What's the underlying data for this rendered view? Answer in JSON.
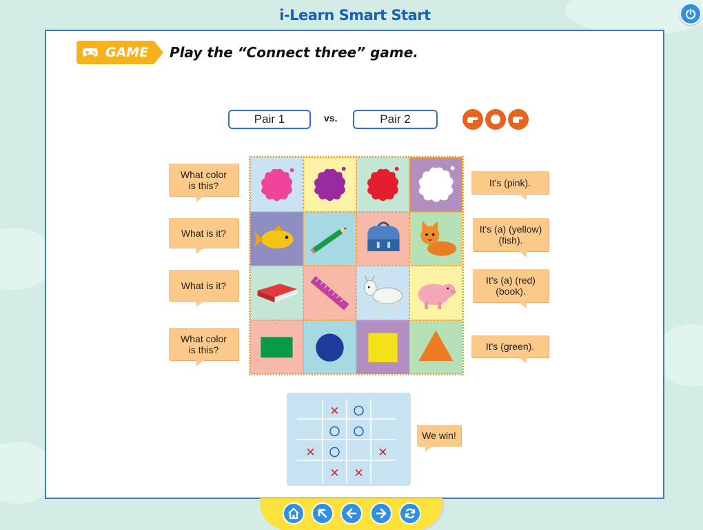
{
  "app": {
    "title": "i-Learn Smart Start"
  },
  "activity": {
    "badge": "GAME",
    "instruction": "Play the “Connect three” game."
  },
  "pairs": {
    "pair1": "Pair 1",
    "vs": "vs.",
    "pair2": "Pair 2"
  },
  "hands": [
    "hand-point-icon",
    "hand-fist-icon",
    "hand-point-icon"
  ],
  "questions": [
    "What color is this?",
    "What is it?",
    "What is it?",
    "What color is this?"
  ],
  "answers": [
    "It's (pink).",
    "It's (a) (yellow) (fish).",
    "It's (a) (red) (book).",
    "It's (green)."
  ],
  "board": {
    "rows": [
      [
        "pink-paint-splat",
        "purple-paint-splat",
        "red-paint-splat",
        "white-paint-splat"
      ],
      [
        "yellow-fish",
        "green-pencil",
        "blue-schoolbag",
        "orange-cat"
      ],
      [
        "red-book",
        "pink-ruler",
        "white-goat",
        "pink-pig"
      ],
      [
        "green-rectangle",
        "blue-circle",
        "yellow-square",
        "orange-triangle"
      ]
    ],
    "colors": {
      "pink": "#f0449a",
      "purple": "#9a2a9f",
      "red": "#e41e2e",
      "green": "#0a9a46",
      "blue": "#1e3a9b",
      "yellow": "#f4e11a",
      "orange": "#ee7a23"
    }
  },
  "tictactoe": {
    "marks": [
      [
        "",
        "X",
        "O",
        ""
      ],
      [
        "",
        "O",
        "O",
        ""
      ],
      [
        "X",
        "O",
        "",
        "X"
      ],
      [
        "",
        "X",
        "X",
        ""
      ]
    ],
    "result": "We win!"
  },
  "nav": [
    "home-icon",
    "up-left-icon",
    "back-arrow-icon",
    "forward-arrow-icon",
    "refresh-icon"
  ]
}
